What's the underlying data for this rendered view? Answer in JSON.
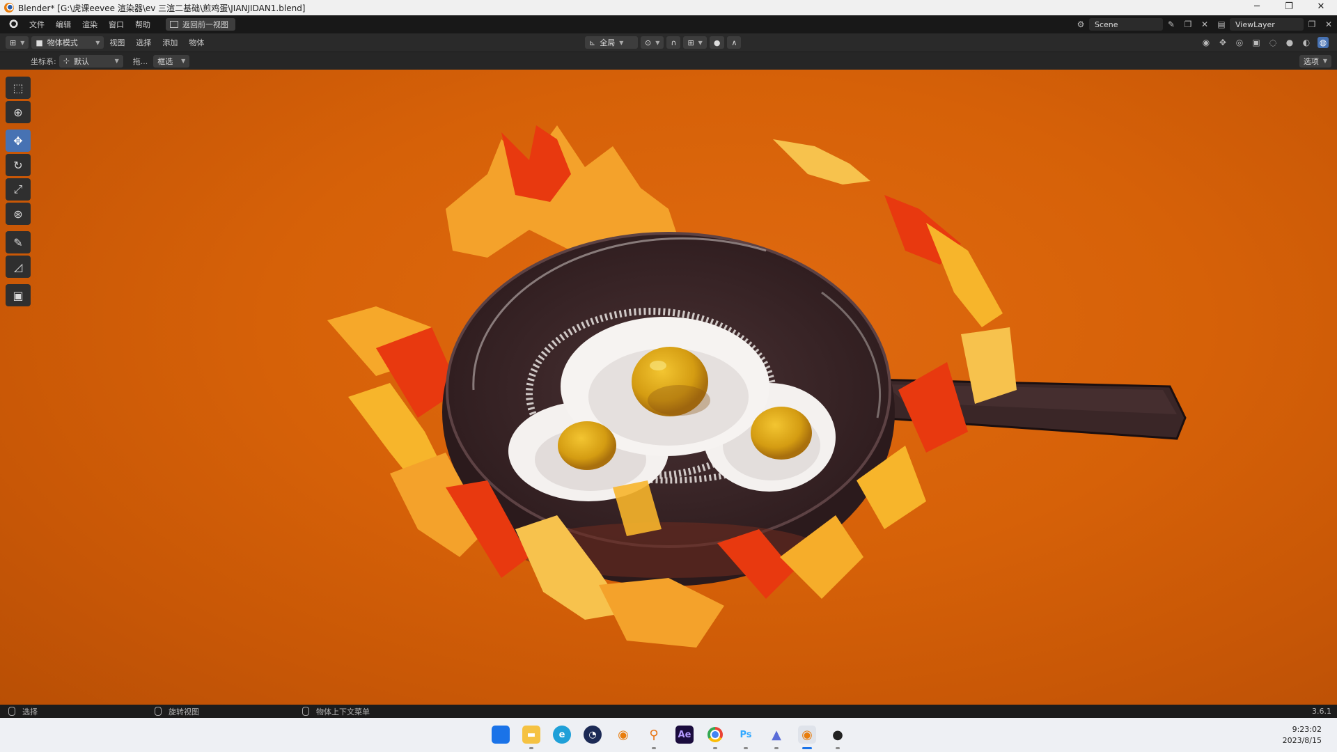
{
  "window": {
    "title": "Blender* [G:\\虎课eevee 渲染器\\ev 三渲二基础\\煎鸡蛋\\JIANJIDAN1.blend]",
    "controls": [
      "─",
      "❐",
      "✕"
    ]
  },
  "topbar": {
    "menus": [
      "文件",
      "编辑",
      "渲染",
      "窗口",
      "帮助"
    ],
    "back_button": "返回前一视图",
    "scene": "Scene",
    "view_layer": "ViewLayer"
  },
  "header": {
    "mode": "物体模式",
    "menus": [
      "视图",
      "选择",
      "添加",
      "物体"
    ],
    "transform_orientation": "全局"
  },
  "tool_settings": {
    "coord_label": "坐标系:",
    "coord_value": "默认",
    "drag_label": "拖...",
    "drag_value": "框选",
    "options": "选项"
  },
  "toolbox": {
    "tools": [
      {
        "name": "select-box",
        "icon": "select-icon",
        "active": false
      },
      {
        "name": "cursor",
        "icon": "cursor-icon",
        "active": false
      },
      {
        "name": "move",
        "icon": "move-icon",
        "active": true
      },
      {
        "name": "rotate",
        "icon": "rotate-icon",
        "active": false
      },
      {
        "name": "scale",
        "icon": "scale-icon",
        "active": false
      },
      {
        "name": "transform",
        "icon": "transform-icon",
        "active": false
      },
      {
        "name": "annotate",
        "icon": "annotate-icon",
        "active": false
      },
      {
        "name": "measure",
        "icon": "measure-icon",
        "active": false
      },
      {
        "name": "add-cube",
        "icon": "add-cube-icon",
        "active": false
      }
    ]
  },
  "statusbar": {
    "select": "选择",
    "rotate_view": "旋转视图",
    "context_menu": "物体上下文菜单",
    "version": "3.6.1"
  },
  "taskbar": {
    "apps": [
      "start",
      "file-explorer",
      "edge",
      "cinema4d",
      "blender",
      "search",
      "after-effects",
      "chrome",
      "photoshop",
      "affinity",
      "blender-active",
      "record"
    ],
    "ae_label": "Ae",
    "ps_label": "Ps",
    "time": "9:23:02",
    "date": "2023/8/15"
  },
  "colors": {
    "accent": "#4772b3",
    "viewport_bg": "#d66108",
    "flame_yellow": "#f7b52b",
    "flame_red": "#e8390f",
    "pan": "#3a2627"
  }
}
